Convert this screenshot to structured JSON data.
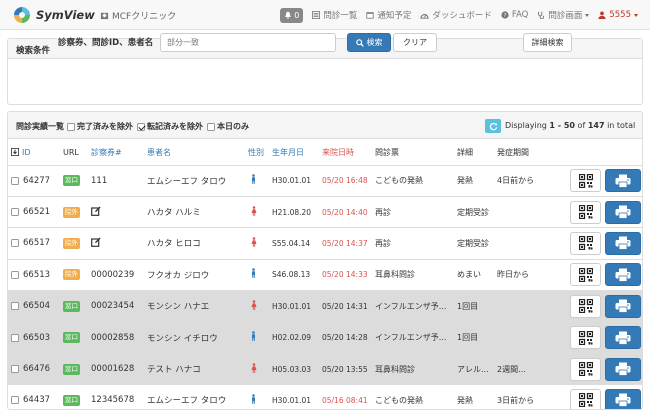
{
  "nav": {
    "brand": "SymView",
    "clinic": "MCFクリニック",
    "notif_count": "0",
    "items": [
      {
        "label": "問診一覧"
      },
      {
        "label": "通知予定"
      },
      {
        "label": "ダッシュボード"
      },
      {
        "label": "FAQ"
      },
      {
        "label": "問診画面"
      }
    ],
    "user": "5555"
  },
  "search": {
    "heading": "検索条件",
    "label": "診察券、問診ID、患者名",
    "placeholder": "部分一致",
    "search_button": "検索",
    "clear_button": "クリア",
    "advanced_button": "詳細検索"
  },
  "results": {
    "title": "問診実績一覧",
    "filters": [
      {
        "label": "完了済みを除外",
        "checked": false
      },
      {
        "label": "転記済みを除外",
        "checked": true
      },
      {
        "label": "本日のみ",
        "checked": false
      }
    ],
    "paging_prefix": "Displaying",
    "paging_range": "1 - 50",
    "paging_of": "of",
    "paging_total": "147",
    "paging_suffix": "in total",
    "columns": {
      "id": "ID",
      "url": "URL",
      "card": "診察券#",
      "name": "患者名",
      "gender": "性別",
      "dob": "生年月日",
      "visit": "来院日時",
      "form": "問診票",
      "detail": "詳細",
      "onset": "発症期間"
    },
    "rows": [
      {
        "id": "64277",
        "url_badge": "窓口",
        "url_type": "green",
        "card": "111",
        "name": "エムシーエフ タロウ",
        "gender": "male",
        "dob": "H30.01.01",
        "visit": "05/20 16:48",
        "form": "こどもの発熱",
        "detail": "発熱",
        "onset": "4日前から",
        "gray": false
      },
      {
        "id": "66521",
        "url_badge": "院外",
        "url_type": "orange",
        "card": "",
        "name": "ハカタ ハルミ",
        "gender": "female",
        "dob": "H21.08.20",
        "visit": "05/20 14:40",
        "form": "再診",
        "detail": "定期受診",
        "onset": "",
        "gray": false
      },
      {
        "id": "66517",
        "url_badge": "院外",
        "url_type": "orange",
        "card": "",
        "name": "ハカタ ヒロコ",
        "gender": "female",
        "dob": "S55.04.14",
        "visit": "05/20 14:37",
        "form": "再診",
        "detail": "定期受診",
        "onset": "",
        "gray": false
      },
      {
        "id": "66513",
        "url_badge": "院外",
        "url_type": "orange",
        "card": "00000239",
        "name": "フクオカ ジロウ",
        "gender": "male",
        "dob": "S46.08.13",
        "visit": "05/20 14:33",
        "form": "耳鼻科問診",
        "detail": "めまい",
        "onset": "昨日から",
        "gray": false
      },
      {
        "id": "66504",
        "url_badge": "窓口",
        "url_type": "green",
        "card": "00023454",
        "name": "モンシン ハナエ",
        "gender": "female",
        "dob": "H30.01.01",
        "visit": "05/20 14:31",
        "form": "インフルエンザ予...",
        "detail": "1回目",
        "onset": "",
        "gray": true
      },
      {
        "id": "66503",
        "url_badge": "窓口",
        "url_type": "green",
        "card": "00002858",
        "name": "モンシン イチロウ",
        "gender": "male",
        "dob": "H02.02.09",
        "visit": "05/20 14:28",
        "form": "インフルエンザ予...",
        "detail": "1回目",
        "onset": "",
        "gray": true
      },
      {
        "id": "66476",
        "url_badge": "窓口",
        "url_type": "green",
        "card": "00001628",
        "name": "テスト ハナコ",
        "gender": "female",
        "dob": "H05.03.03",
        "visit": "05/20 13:55",
        "form": "耳鼻科問診",
        "detail": "アレル...",
        "onset": "2週間...",
        "gray": true
      },
      {
        "id": "64437",
        "url_badge": "窓口",
        "url_type": "green",
        "card": "12345678",
        "name": "エムシーエフ タロウ",
        "gender": "male",
        "dob": "H30.01.01",
        "visit": "05/16 08:41",
        "form": "こどもの発熱",
        "detail": "発熱",
        "onset": "3日前から",
        "gray": false
      }
    ]
  },
  "colors": {
    "primary": "#337ab7",
    "danger": "#d9534f",
    "success": "#5cb85c",
    "warning": "#f0ad4e",
    "info": "#5bc0de",
    "male": "#337ab7",
    "female": "#d9534f"
  }
}
